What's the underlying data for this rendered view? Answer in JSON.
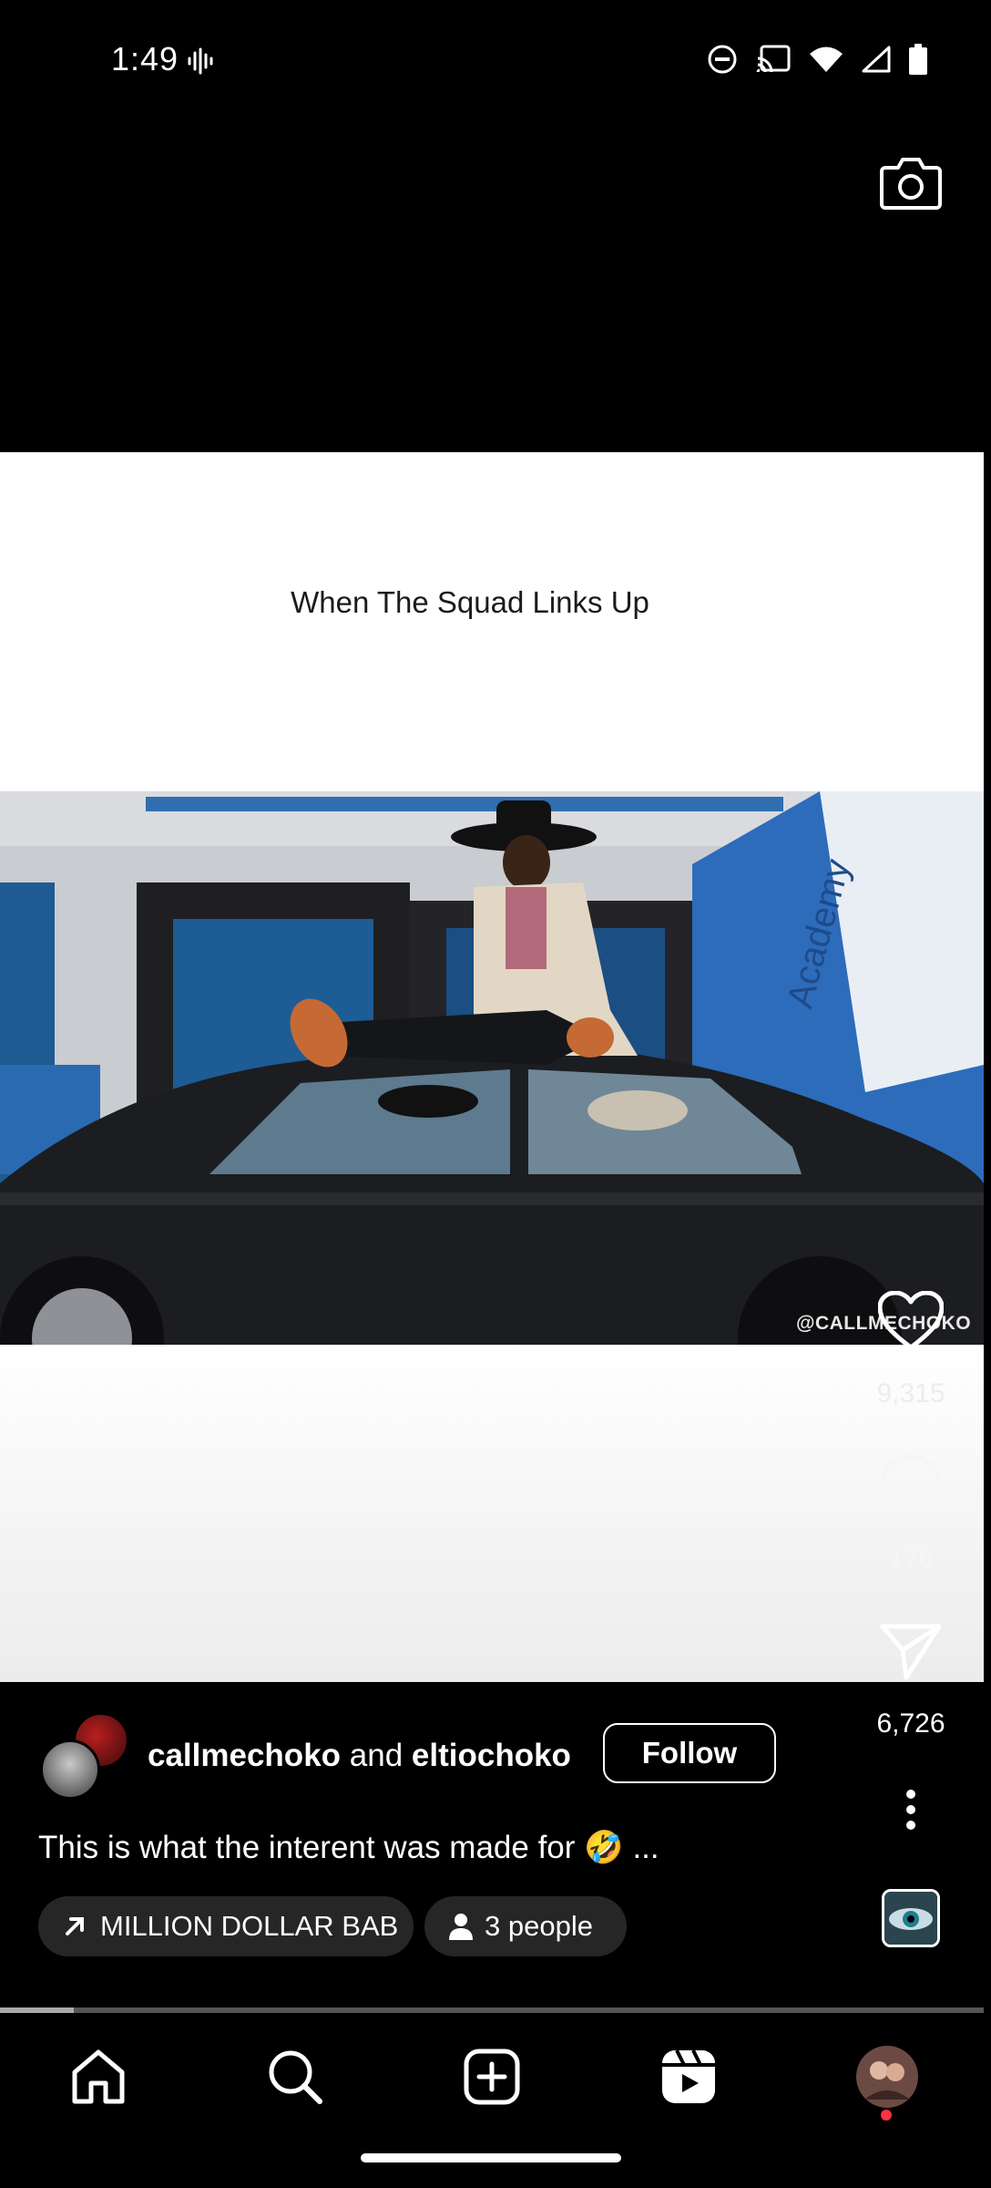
{
  "status_bar": {
    "time": "1:49",
    "icons": [
      "waveform-icon",
      "do-not-disturb-icon",
      "cast-icon",
      "wifi-icon",
      "cellular-signal-icon",
      "battery-icon"
    ]
  },
  "top_bar": {
    "camera_icon": "camera-icon"
  },
  "video": {
    "overlay_caption": "When The Squad Links Up",
    "watermark": "@CALLMECHOKO"
  },
  "actions": {
    "likes": "9,315",
    "comments": "176",
    "shares": "6,726"
  },
  "post": {
    "author1": "callmechoko",
    "joiner": "and",
    "author2": "eltiochoko",
    "follow_label": "Follow",
    "caption": "This is what the interent was made for 🤣 ...",
    "audio_chip": "MILLION DOLLAR BAB",
    "people_chip": "3 people",
    "progress": 0.075
  },
  "bottom_nav": {
    "items": [
      "home-icon",
      "search-icon",
      "create-icon",
      "reels-icon",
      "profile-avatar"
    ]
  },
  "colors": {
    "background": "#000000",
    "accent_dot": "#ff3040"
  }
}
